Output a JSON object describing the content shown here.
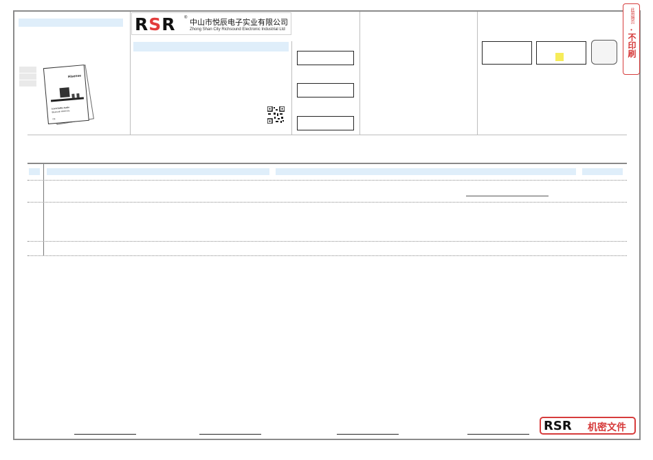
{
  "company": {
    "logo_letters": [
      "R",
      "S",
      "R"
    ],
    "registered_mark": "®",
    "name_cn": "中山市悦辰电子实业有限公司",
    "name_en": "Zhong Shan City Richsound Electronic Industrial Ltd"
  },
  "stamp": {
    "small_text": "此用隔页",
    "dot": "•",
    "big_text": "不印刷"
  },
  "manual_preview": {
    "brand": "Hisense",
    "title": "5.1ch Dolby Audio",
    "logos": "Bluetooth HDMI dts",
    "footer": "CE"
  },
  "confidential_badge": {
    "logo": "RSR",
    "text": "机密文件"
  },
  "colors": {
    "highlight_fill": "#dfeefa",
    "stamp_red": "#d63a3a",
    "marker_yellow": "#f6ec5a"
  }
}
